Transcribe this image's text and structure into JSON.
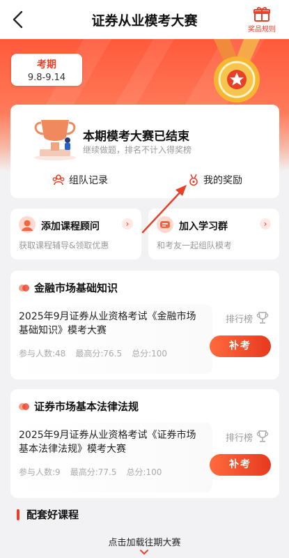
{
  "header": {
    "title": "证券从业模考大赛",
    "rules_label": "奖品规则"
  },
  "period": {
    "title": "考期",
    "range": "9.8-9.14"
  },
  "status": {
    "title": "本期模考大赛已结束",
    "subtitle": "继续做题，排名不计入得奖榜"
  },
  "links": {
    "team_record": "组队记录",
    "my_rewards": "我的奖励"
  },
  "promo": [
    {
      "title": "添加课程顾问",
      "subtitle": "获取课程辅导&领取优惠"
    },
    {
      "title": "加入学习群",
      "subtitle": "和考友一起组队模考"
    }
  ],
  "exams": [
    {
      "category": "金融市场基础知识",
      "name": "2025年9月证券从业资格考试《金融市场基础知识》模考大赛",
      "participants": "参与人数:48",
      "high_score": "最高分:76.5",
      "total": "总分:100",
      "rank_label": "排行榜",
      "action": "补考"
    },
    {
      "category": "证券市场基本法律法规",
      "name": "2025年9月证券从业资格考试《证券市场基本法律法规》模考大赛",
      "participants": "参与人数:9",
      "high_score": "最高分:77.5",
      "total": "总分:100",
      "rank_label": "排行榜",
      "action": "补考"
    }
  ],
  "courses": {
    "title": "配套好课程",
    "load_more": "点击加载往期大赛"
  },
  "colors": {
    "accent": "#e8412a",
    "hero": "#ff5a3a",
    "gold": "#f5b731"
  },
  "icons": [
    "back-icon",
    "gift-icon",
    "medal-icon",
    "trophy-icon",
    "team-icon",
    "award-icon",
    "rank-cup-icon",
    "chevron-down-icon"
  ]
}
